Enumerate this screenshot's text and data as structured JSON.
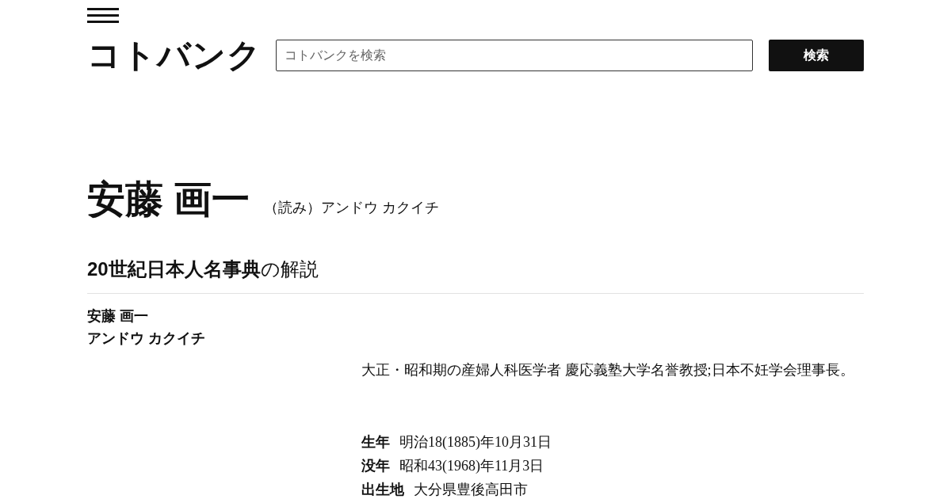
{
  "header": {
    "logo": "コトバンク",
    "search": {
      "placeholder": "コトバンクを検索"
    },
    "search_button": "検索"
  },
  "entry": {
    "title": "安藤 画一",
    "reading": "（読み）アンドウ カクイチ"
  },
  "section": {
    "heading": "**20世紀日本人名事典**の解説",
    "name": "安藤 画一",
    "name_reading": "アンドウ カクイチ",
    "description": "大正・昭和期の産婦人科医学者 慶応義塾大学名誉教授;日本不妊学会理事長。",
    "facts": [
      {
        "label": "生年",
        "value": "明治18(1885)年10月31日"
      },
      {
        "label": "没年",
        "value": "昭和43(1968)年11月3日"
      },
      {
        "label": "出生地",
        "value": "大分県豊後高田市"
      }
    ]
  }
}
